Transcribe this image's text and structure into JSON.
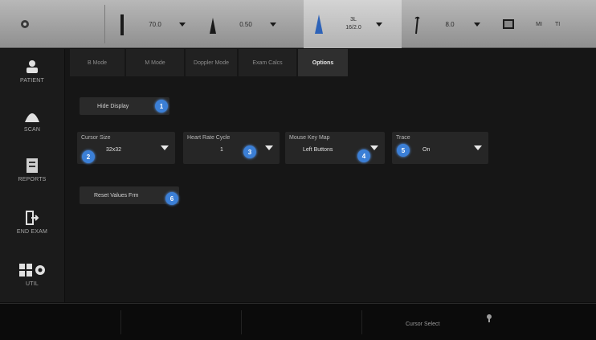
{
  "topbar": {
    "groups": [
      {
        "value": "70.0"
      },
      {
        "value": "0.50"
      },
      {
        "value_line1": "3L",
        "value_line2": "16/2.0"
      },
      {
        "value": "8.0"
      },
      {
        "value": "MI"
      }
    ],
    "overflow_label": "TI"
  },
  "sidebar": {
    "items": [
      {
        "label": "PATIENT"
      },
      {
        "label": "SCAN"
      },
      {
        "label": "REPORTS"
      },
      {
        "label": "END EXAM"
      },
      {
        "label": "UTIL"
      }
    ]
  },
  "tabs": [
    {
      "label": "B Mode"
    },
    {
      "label": "M Mode"
    },
    {
      "label": "Doppler Mode"
    },
    {
      "label": "Exam Calcs"
    },
    {
      "label": "Options"
    }
  ],
  "options": {
    "hide_display": {
      "label": "Hide Display",
      "badge": "1"
    },
    "cursor_size": {
      "label": "Cursor Size",
      "value": "32x32",
      "badge": "2"
    },
    "heart_rate_cycle": {
      "label": "Heart Rate Cycle",
      "value": "1",
      "badge": "3"
    },
    "mouse_key_map": {
      "label": "Mouse Key Map",
      "value": "Left Buttons",
      "badge": "4"
    },
    "trace": {
      "label": "Trace",
      "value": "On",
      "badge": "5"
    },
    "reset_values": {
      "label": "Reset Values Frm",
      "badge": "6"
    }
  },
  "statusbar": {
    "text": "Cursor Select"
  },
  "colors": {
    "accent": "#3b7fd6",
    "background": "#161616",
    "topbar": "#a8a8a8"
  }
}
